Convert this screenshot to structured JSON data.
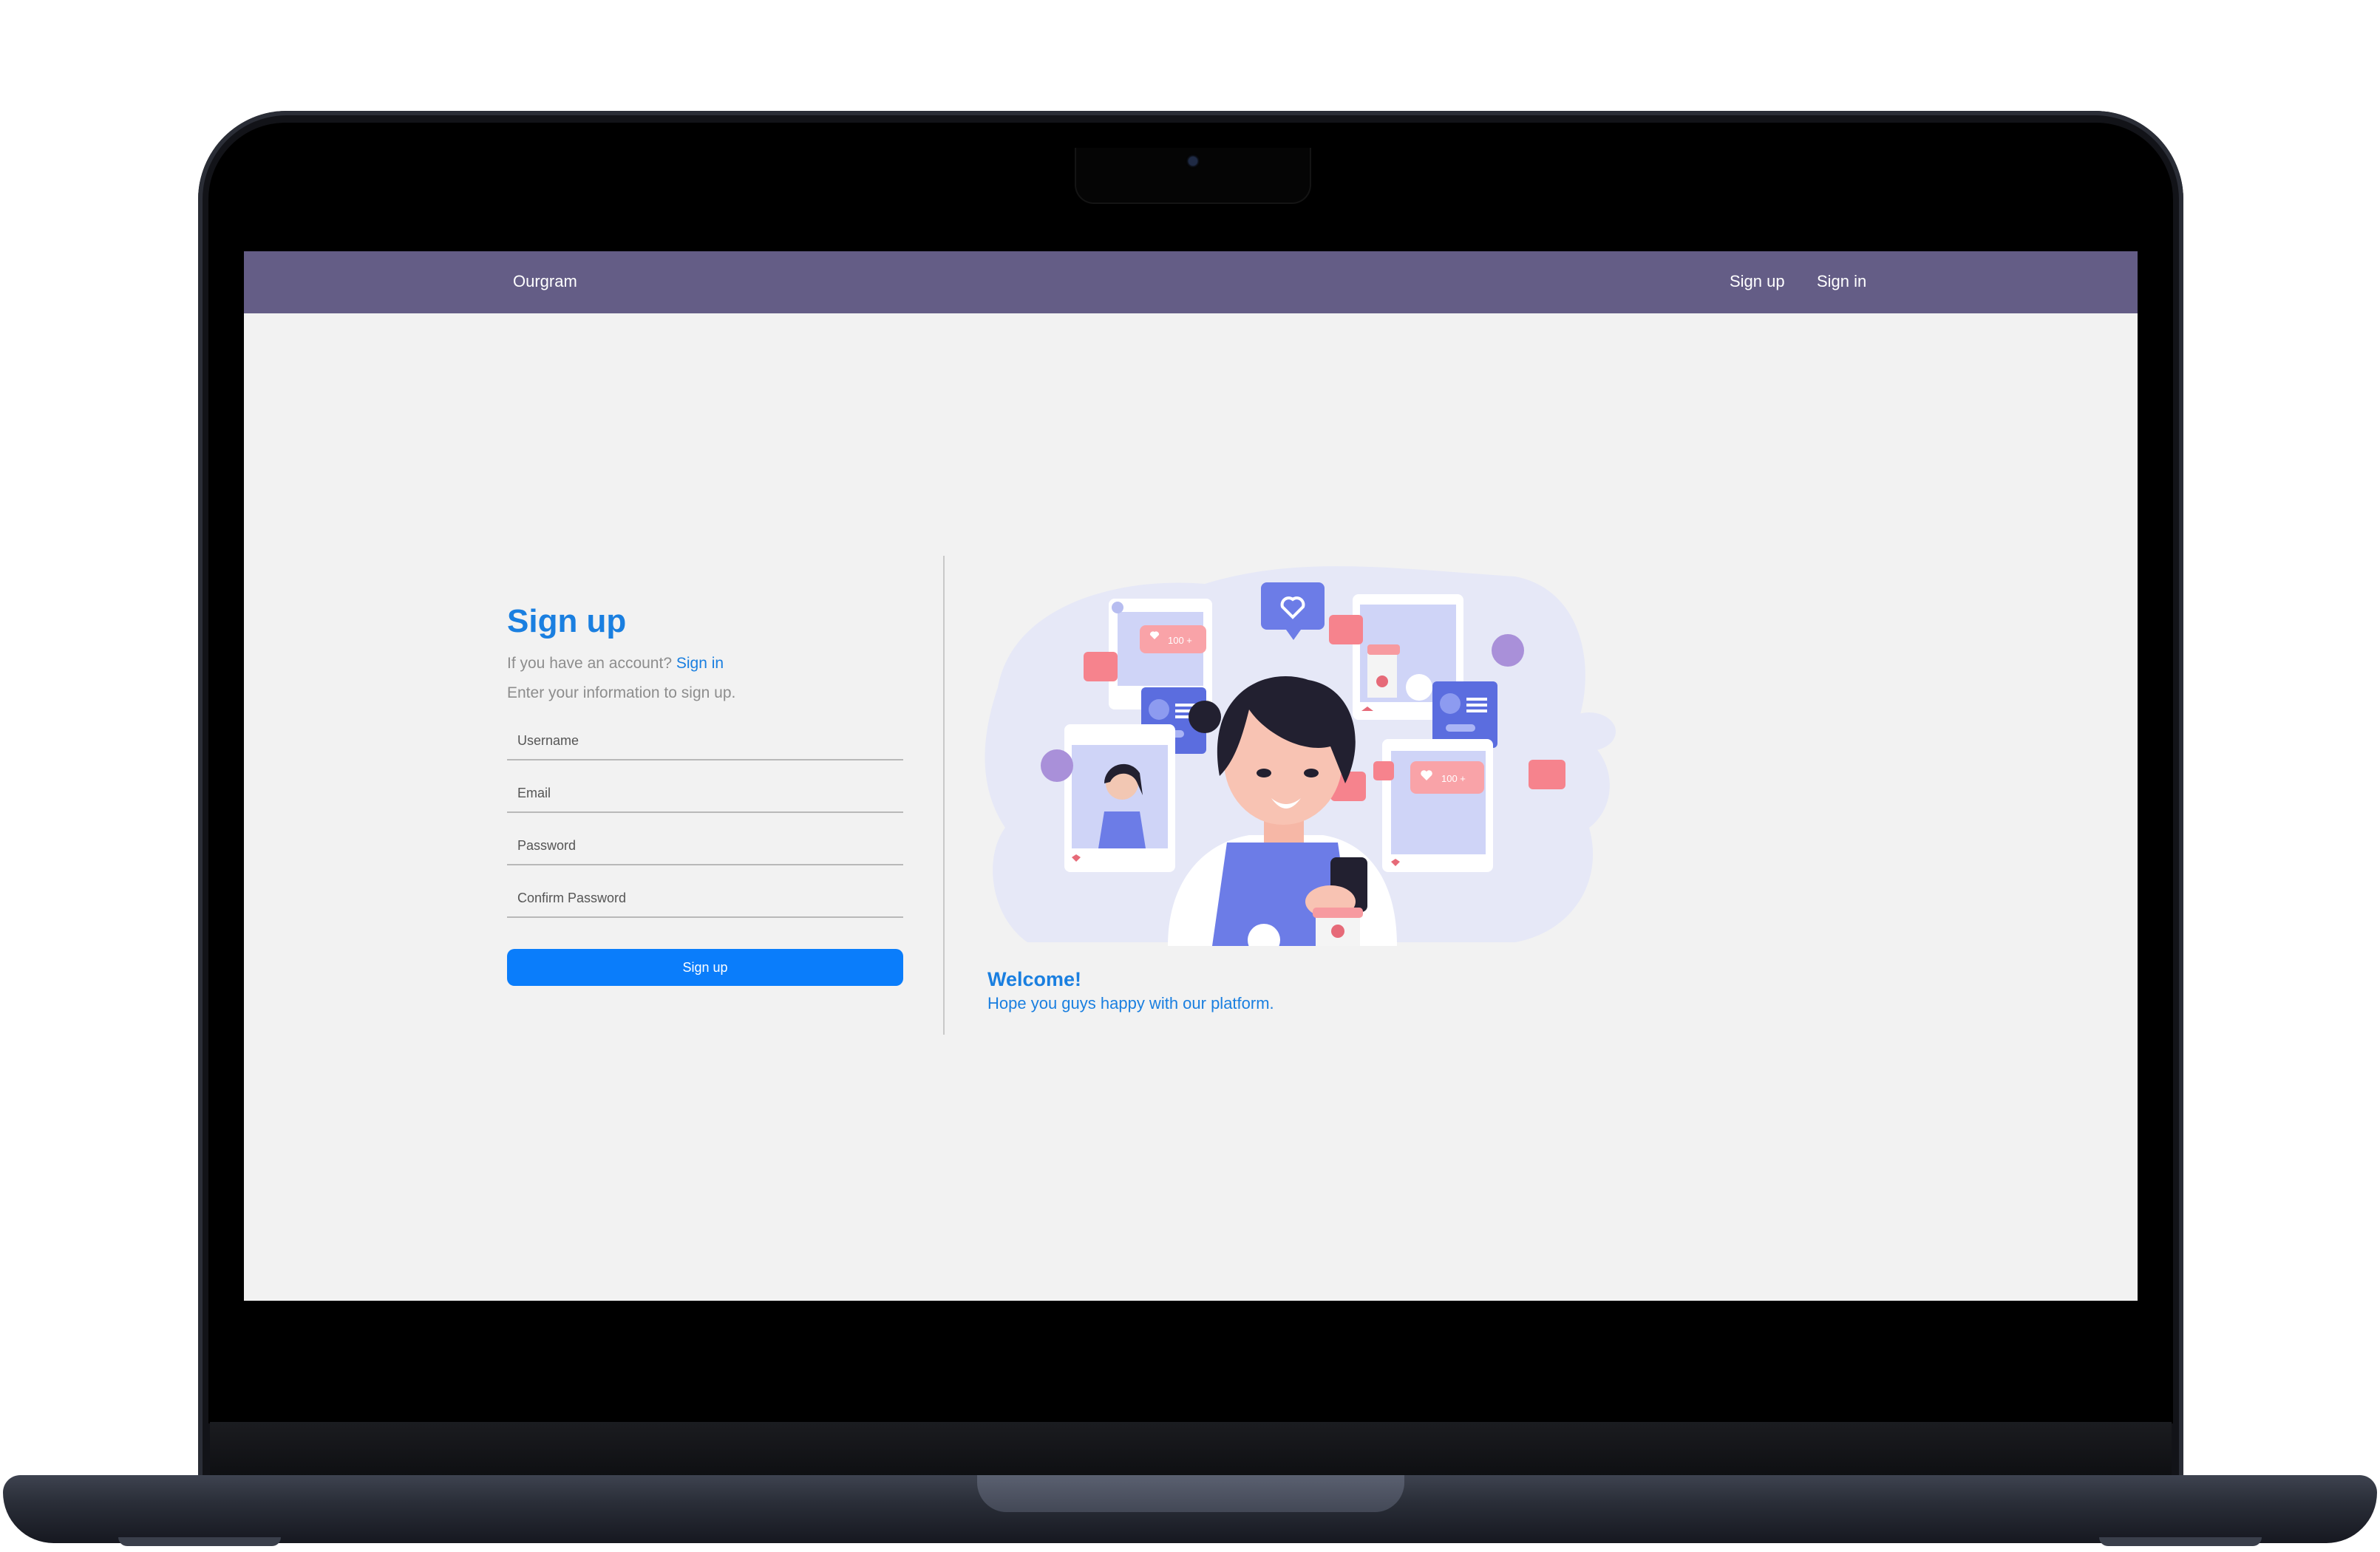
{
  "app": {
    "brand": "Ourgram"
  },
  "nav": {
    "signup_label": "Sign up",
    "signin_label": "Sign in"
  },
  "form": {
    "title": "Sign up",
    "account_prompt": "If you have an account?",
    "signin_link": "Sign in",
    "instructions": "Enter your information to sign up.",
    "username_placeholder": "Username",
    "email_placeholder": "Email",
    "password_placeholder": "Password",
    "confirm_password_placeholder": "Confirm Password",
    "submit_label": "Sign up"
  },
  "welcome": {
    "title": "Welcome!",
    "text": "Hope you guys happy with our platform."
  },
  "illustration": {
    "hearts_label_left": "100 +",
    "hearts_label_right": "100 +"
  },
  "colors": {
    "navbar": "#645d86",
    "accent": "#1a7fe0",
    "button": "#0a7dfb",
    "screen_bg": "#f2f2f2"
  }
}
